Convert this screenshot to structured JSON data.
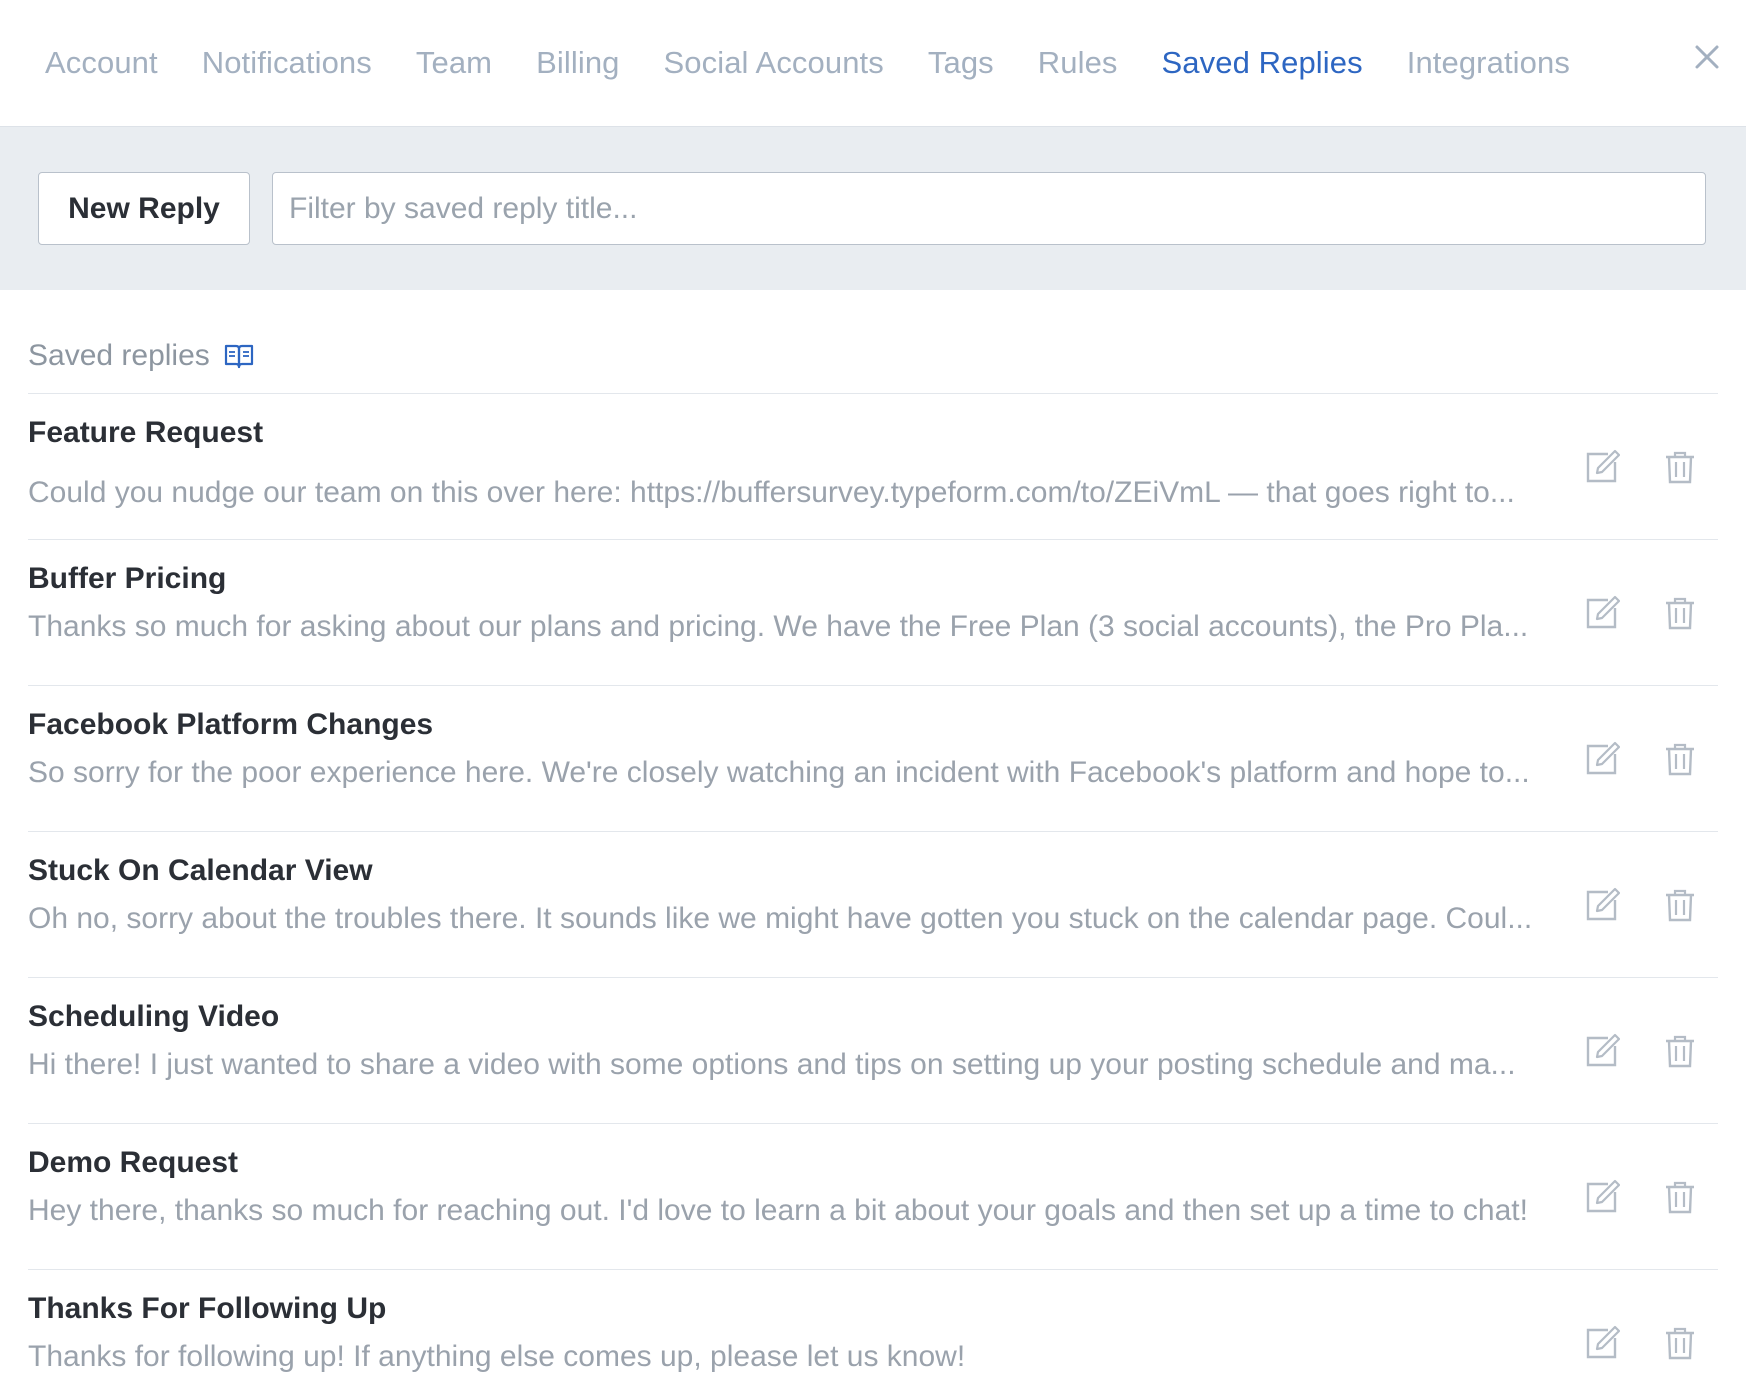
{
  "nav": {
    "tabs": [
      {
        "label": "Account",
        "active": false
      },
      {
        "label": "Notifications",
        "active": false
      },
      {
        "label": "Team",
        "active": false
      },
      {
        "label": "Billing",
        "active": false
      },
      {
        "label": "Social Accounts",
        "active": false
      },
      {
        "label": "Tags",
        "active": false
      },
      {
        "label": "Rules",
        "active": false
      },
      {
        "label": "Saved Replies",
        "active": true
      },
      {
        "label": "Integrations",
        "active": false
      }
    ],
    "close_icon": "close-icon"
  },
  "toolbar": {
    "new_reply_label": "New Reply",
    "filter_placeholder": "Filter by saved reply title...",
    "filter_value": ""
  },
  "section": {
    "title": "Saved replies",
    "title_icon": "book-icon"
  },
  "replies": [
    {
      "title": "Feature Request",
      "body": "Could you nudge our team on this over here: https://buffersurvey.typeform.com/to/ZEiVmL — that goes right to..."
    },
    {
      "title": "Buffer Pricing",
      "body": "Thanks so much for asking about our plans and pricing. We have the Free Plan (3 social accounts), the Pro Pla..."
    },
    {
      "title": "Facebook Platform Changes",
      "body": "So sorry for the poor experience here. We're closely watching an incident with Facebook's platform and hope to..."
    },
    {
      "title": "Stuck On Calendar View",
      "body": "Oh no, sorry about the troubles there. It sounds like we might have gotten you stuck on the calendar page. Coul..."
    },
    {
      "title": "Scheduling Video",
      "body": "Hi there! I just wanted to share a video with some options and tips on setting up your posting schedule and ma..."
    },
    {
      "title": "Demo Request",
      "body": "Hey there, thanks so much for reaching out. I'd love to learn a bit about your goals and then set up a time to chat!"
    },
    {
      "title": "Thanks For Following Up",
      "body": "Thanks for following up! If anything else comes up, please let us know!"
    }
  ],
  "colors": {
    "accent": "#2d66c2",
    "tab_inactive": "#a3b0c0",
    "toolbar_bg": "#e9edf1",
    "icon_gray": "#b4bcc6"
  }
}
